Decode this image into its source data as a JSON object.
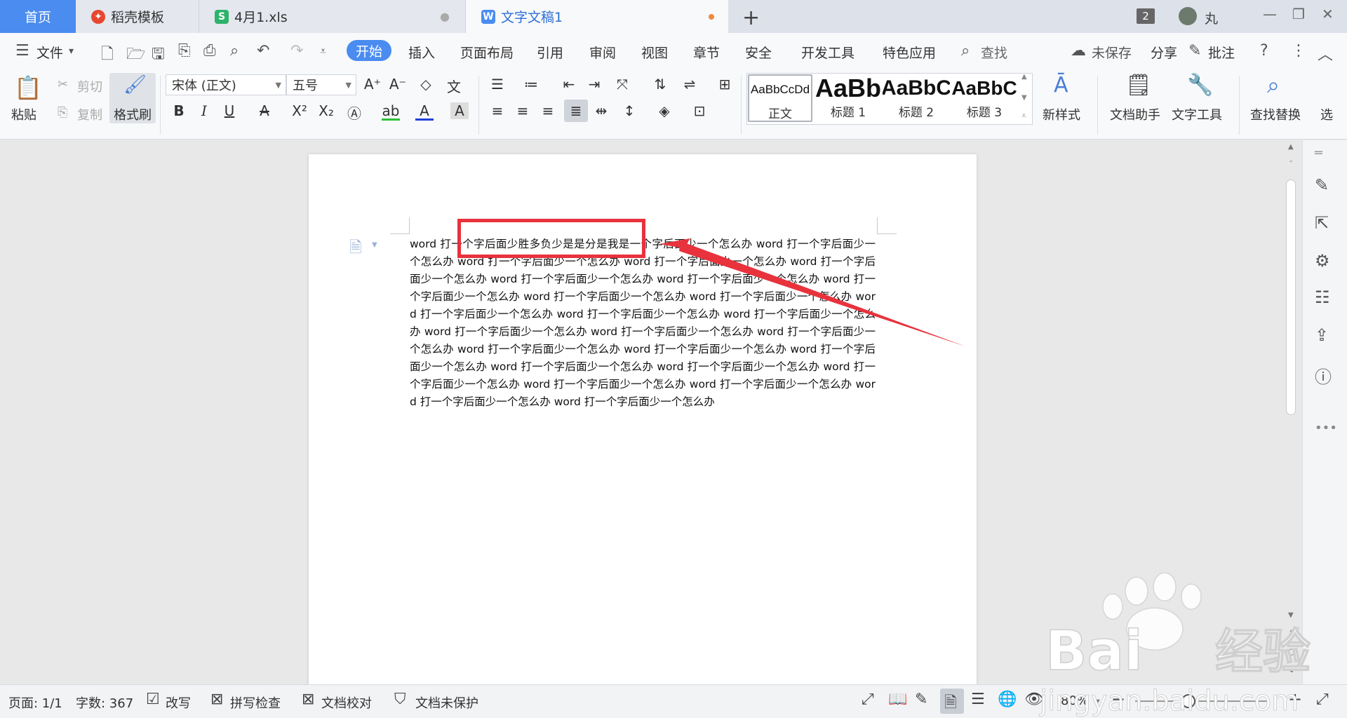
{
  "tabs": {
    "home": "首页",
    "tab1": {
      "label": "稻壳模板",
      "icon_color": "#e8472f"
    },
    "tab2": {
      "label": "4月1.xls",
      "icon_color": "#2db36b",
      "icon_letter": "S"
    },
    "tab3": {
      "label": "文字文稿1",
      "icon_color": "#4a8cf0",
      "icon_letter": "W"
    },
    "new_tab": "+"
  },
  "window": {
    "badge": "2",
    "username": "丸"
  },
  "menu": {
    "file": "文件",
    "items": [
      "开始",
      "插入",
      "页面布局",
      "引用",
      "审阅",
      "视图",
      "章节",
      "安全",
      "开发工具",
      "特色应用"
    ],
    "search": "查找",
    "unsaved": "未保存",
    "share": "分享",
    "comment": "批注"
  },
  "ribbon": {
    "paste": "粘贴",
    "cut": "剪切",
    "copy": "复制",
    "format_painter": "格式刷",
    "font_name": "宋体 (正文)",
    "font_size": "五号",
    "styles": [
      {
        "preview": "AaBbCcDd",
        "name": "正文"
      },
      {
        "preview": "AaBb",
        "name": "标题 1"
      },
      {
        "preview": "AaBbC",
        "name": "标题 2"
      },
      {
        "preview": "AaBbC",
        "name": "标题 3"
      }
    ],
    "new_style": "新样式",
    "doc_assistant": "文档助手",
    "text_tools": "文字工具",
    "find_replace": "查找替换",
    "select": "选"
  },
  "document": {
    "text": "word 打一个字后面少胜多负少是是分是我是一个字后面少一个怎么办 word 打一个字后面少一个怎么办 word 打一个字后面少一个怎么办 word 打一个字后面少一个怎么办 word 打一个字后面少一个怎么办 word 打一个字后面少一个怎么办 word 打一个字后面少一个怎么办 word 打一个字后面少一个怎么办 word 打一个字后面少一个怎么办 word 打一个字后面少一个怎么办 word 打一个字后面少一个怎么办 word 打一个字后面少一个怎么办 word 打一个字后面少一个怎么办 word 打一个字后面少一个怎么办 word 打一个字后面少一个怎么办 word 打一个字后面少一个怎么办 word 打一个字后面少一个怎么办 word 打一个字后面少一个怎么办 word 打一个字后面少一个怎么办 word 打一个字后面少一个怎么办 word 打一个字后面少一个怎么办 word 打一个字后面少一个怎么办 word 打一个字后面少一个怎么办 word 打一个字后面少一个怎么办 word 打一个字后面少一个怎么办 word 打一个字后面少一个怎么办"
  },
  "status": {
    "page": "页面: 1/1",
    "word_count": "字数: 367",
    "revise": "改写",
    "spell_check": "拼写检查",
    "doc_proof": "文档校对",
    "doc_unprotected": "文档未保护",
    "zoom": "80%"
  },
  "watermark": {
    "brand": "Bai",
    "brand2": "经验",
    "url": "jingyan.baidu.com"
  },
  "colors": {
    "accent": "#4a8cf0",
    "highlight": "#e8323c"
  }
}
